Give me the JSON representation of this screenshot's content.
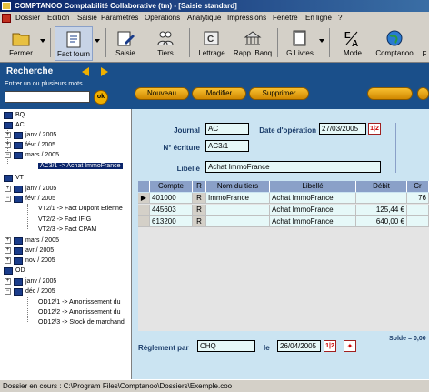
{
  "window": {
    "title": "COMPTANOO Comptabilité Collaborative (tm) - [Saisie standard]"
  },
  "menu": [
    "Dossier",
    "Edition",
    "Saisie",
    "Paramètres",
    "Opérations",
    "Analytique",
    "Impressions",
    "Fenêtre",
    "En ligne",
    "?"
  ],
  "toolbar": {
    "fermer": "Fermer",
    "fact_fourn": "Fact fourn",
    "saisie": "Saisie",
    "tiers": "Tiers",
    "lettrage": "Lettrage",
    "rapp_banq": "Rapp. Banq",
    "g_livres": "G Livres",
    "mode": "Mode",
    "comptanoo": "Comptanoo",
    "f": "F"
  },
  "search": {
    "title": "Recherche",
    "hint": "Entrer un ou plusieurs mots",
    "value": "",
    "ok": "ok"
  },
  "actions": {
    "nouveau": "Nouveau",
    "modifier": "Modifier",
    "supprimer": "Supprimer"
  },
  "tree": {
    "bq": "BQ",
    "ac": "AC",
    "ac_janv": "janv / 2005",
    "ac_fevr": "févr / 2005",
    "ac_mars": "mars / 2005",
    "ac_mars_item": "AC3/1 -> Achat ImmoFrance",
    "vt": "VT",
    "vt_janv": "janv / 2005",
    "vt_fevr": "févr / 2005",
    "vt_fevr_1": "VT2/1 -> Fact Dupont Etienne",
    "vt_fevr_2": "VT2/2 -> Fact IFIG",
    "vt_fevr_3": "VT2/3 -> Fact CPAM",
    "vt_mars": "mars / 2005",
    "vt_avr": "avr / 2005",
    "vt_nov": "nov / 2005",
    "od": "OD",
    "od_janv": "janv / 2005",
    "od_dec": "déc / 2005",
    "od_dec_1": "OD12/1 -> Amortissement du",
    "od_dec_2": "OD12/2 -> Amortissement du",
    "od_dec_3": "OD12/3 -> Stock de marchand"
  },
  "form": {
    "journal_label": "Journal",
    "journal_value": "AC",
    "date_label": "Date d'opération",
    "date_value": "27/03/2005",
    "ecriture_label": "N° écriture",
    "ecriture_value": "AC3/1",
    "libelle_label": "Libellé",
    "libelle_value": "Achat ImmoFrance",
    "cal_icon": "1|2"
  },
  "grid": {
    "headers": {
      "compte": "Compte",
      "r": "R",
      "tiers": "Nom du tiers",
      "libelle": "Libellé",
      "debit": "Débit",
      "credit": "Cr"
    },
    "rows": [
      {
        "compte": "401000",
        "r": "R",
        "tiers": "ImmoFrance",
        "libelle": "Achat ImmoFrance",
        "debit": "",
        "credit": "76"
      },
      {
        "compte": "445603",
        "r": "R",
        "tiers": "",
        "libelle": "Achat ImmoFrance",
        "debit": "125,44 €",
        "credit": ""
      },
      {
        "compte": "613200",
        "r": "R",
        "tiers": "",
        "libelle": "Achat ImmoFrance",
        "debit": "640,00 €",
        "credit": ""
      }
    ]
  },
  "footer": {
    "solde": "Solde = 0,00",
    "reglement_label": "Règlement par",
    "reglement_value": "CHQ",
    "le_label": "le",
    "le_value": "26/04/2005"
  },
  "status": {
    "text": "Dossier en cours : C:\\Program Files\\Comptanoo\\Dossiers\\Exemple.coo"
  },
  "colors": {
    "accent": "#1a4f8a",
    "form_bg": "#cbe4f2",
    "button": "#f0b000"
  }
}
